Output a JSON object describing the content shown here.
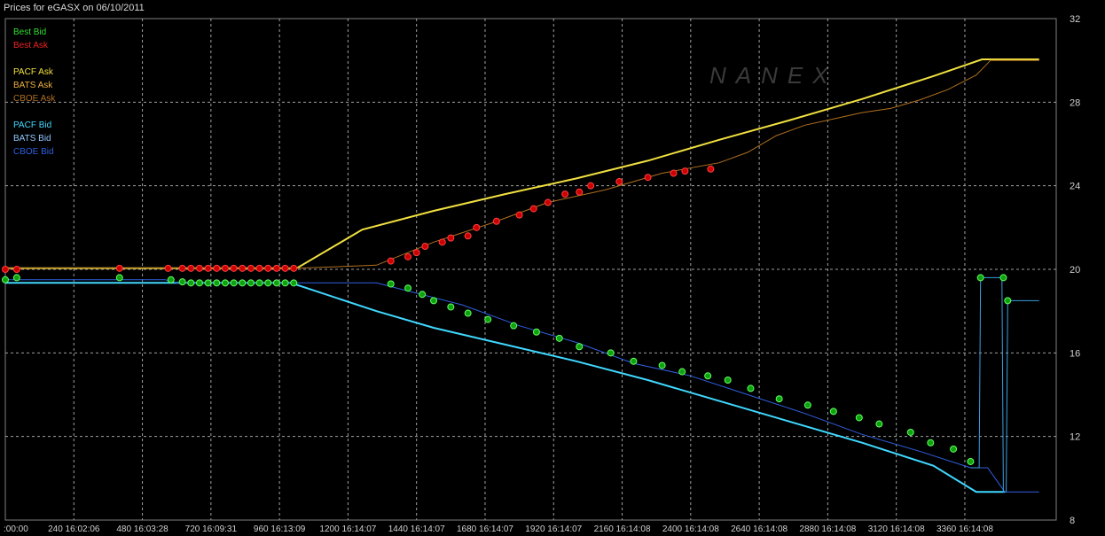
{
  "chart_data": {
    "type": "line",
    "title": "Prices for  eGASX  on  06/10/2011",
    "watermark": "NANEX",
    "ylim": [
      8,
      32
    ],
    "yticks": [
      8,
      12,
      16,
      20,
      24,
      28,
      32
    ],
    "xlim": [
      0,
      3680
    ],
    "xticks": [
      {
        "x": 0,
        "label": ":00:00"
      },
      {
        "x": 240,
        "label": "240 16:02:06"
      },
      {
        "x": 480,
        "label": "480 16:03:28"
      },
      {
        "x": 720,
        "label": "720 16:09:31"
      },
      {
        "x": 960,
        "label": "960 16:13:09"
      },
      {
        "x": 1200,
        "label": "1200 16:14:07"
      },
      {
        "x": 1440,
        "label": "1440 16:14:07"
      },
      {
        "x": 1680,
        "label": "1680 16:14:07"
      },
      {
        "x": 1920,
        "label": "1920 16:14:07"
      },
      {
        "x": 2160,
        "label": "2160 16:14:08"
      },
      {
        "x": 2400,
        "label": "2400 16:14:08"
      },
      {
        "x": 2640,
        "label": "2640 16:14:08"
      },
      {
        "x": 2880,
        "label": "2880 16:14:08"
      },
      {
        "x": 3120,
        "label": "3120 16:14:08"
      },
      {
        "x": 3360,
        "label": "3360 16:14:08"
      }
    ],
    "grid": true,
    "legend_position": "top-left",
    "legend": [
      {
        "name": "Best Bid",
        "color": "#33dd33"
      },
      {
        "name": "Best Ask",
        "color": "#ee2222"
      },
      {
        "name": "PACF Ask",
        "color": "#f0e040"
      },
      {
        "name": "BATS Ask",
        "color": "#e8b040"
      },
      {
        "name": "CBOE Ask",
        "color": "#b07020"
      },
      {
        "name": "PACF Bid",
        "color": "#40d8ff"
      },
      {
        "name": "BATS Bid",
        "color": "#90c8ff"
      },
      {
        "name": "CBOE Bid",
        "color": "#3060e0"
      }
    ],
    "series": [
      {
        "name": "PACF Ask",
        "color": "#f0e040",
        "width": 2,
        "points": [
          [
            0,
            20.05
          ],
          [
            1020,
            20.05
          ],
          [
            1250,
            21.9
          ],
          [
            1500,
            22.8
          ],
          [
            1750,
            23.6
          ],
          [
            2000,
            24.35
          ],
          [
            2250,
            25.2
          ],
          [
            2500,
            26.2
          ],
          [
            2750,
            27.15
          ],
          [
            3000,
            28.15
          ],
          [
            3250,
            29.25
          ],
          [
            3420,
            30.05
          ],
          [
            3620,
            30.05
          ]
        ]
      },
      {
        "name": "CBOE Ask",
        "color": "#b07020",
        "width": 1,
        "points": [
          [
            0,
            20.05
          ],
          [
            1020,
            20.05
          ],
          [
            1300,
            20.2
          ],
          [
            1500,
            21.3
          ],
          [
            1700,
            22.2
          ],
          [
            1900,
            23.2
          ],
          [
            2100,
            23.8
          ],
          [
            2300,
            24.6
          ],
          [
            2500,
            25.1
          ],
          [
            2600,
            25.6
          ],
          [
            2700,
            26.4
          ],
          [
            2800,
            26.9
          ],
          [
            2900,
            27.2
          ],
          [
            3000,
            27.5
          ],
          [
            3100,
            27.7
          ],
          [
            3200,
            28.1
          ],
          [
            3300,
            28.6
          ],
          [
            3400,
            29.3
          ],
          [
            3450,
            30.0
          ],
          [
            3620,
            30.0
          ]
        ]
      },
      {
        "name": "PACF Bid",
        "color": "#40d8ff",
        "width": 2,
        "points": [
          [
            0,
            19.35
          ],
          [
            580,
            19.35
          ],
          [
            1000,
            19.35
          ],
          [
            1300,
            18.0
          ],
          [
            1500,
            17.2
          ],
          [
            1750,
            16.4
          ],
          [
            2000,
            15.6
          ],
          [
            2250,
            14.7
          ],
          [
            2500,
            13.7
          ],
          [
            2750,
            12.7
          ],
          [
            3000,
            11.7
          ],
          [
            3250,
            10.6
          ],
          [
            3400,
            9.35
          ],
          [
            3500,
            9.35
          ]
        ]
      },
      {
        "name": "CBOE Bid",
        "color": "#3060e0",
        "width": 1,
        "points": [
          [
            0,
            19.5
          ],
          [
            560,
            19.5
          ],
          [
            600,
            19.35
          ],
          [
            1000,
            19.35
          ],
          [
            1300,
            19.35
          ],
          [
            1400,
            19.0
          ],
          [
            1600,
            18.3
          ],
          [
            1800,
            17.3
          ],
          [
            2000,
            16.5
          ],
          [
            2200,
            15.5
          ],
          [
            2400,
            14.9
          ],
          [
            2600,
            14.0
          ],
          [
            2800,
            13.1
          ],
          [
            3000,
            12.1
          ],
          [
            3200,
            11.3
          ],
          [
            3380,
            10.5
          ],
          [
            3440,
            10.5
          ],
          [
            3500,
            9.35
          ],
          [
            3620,
            9.35
          ]
        ]
      },
      {
        "name": "BATS Bid",
        "color": "#3aa0e0",
        "width": 1,
        "points": [
          [
            3380,
            10.5
          ],
          [
            3410,
            10.5
          ],
          [
            3415,
            19.6
          ],
          [
            3490,
            19.6
          ],
          [
            3495,
            9.35
          ],
          [
            3505,
            9.35
          ],
          [
            3510,
            18.5
          ],
          [
            3620,
            18.5
          ]
        ]
      }
    ],
    "best_ask_markers": [
      [
        0,
        20.0
      ],
      [
        40,
        20.0
      ],
      [
        400,
        20.05
      ],
      [
        570,
        20.05
      ],
      [
        620,
        20.05
      ],
      [
        650,
        20.05
      ],
      [
        680,
        20.05
      ],
      [
        710,
        20.05
      ],
      [
        740,
        20.05
      ],
      [
        770,
        20.05
      ],
      [
        800,
        20.05
      ],
      [
        830,
        20.05
      ],
      [
        860,
        20.05
      ],
      [
        890,
        20.05
      ],
      [
        920,
        20.05
      ],
      [
        950,
        20.05
      ],
      [
        980,
        20.05
      ],
      [
        1010,
        20.05
      ],
      [
        1350,
        20.4
      ],
      [
        1410,
        20.6
      ],
      [
        1440,
        20.8
      ],
      [
        1470,
        21.1
      ],
      [
        1530,
        21.3
      ],
      [
        1560,
        21.5
      ],
      [
        1620,
        21.6
      ],
      [
        1650,
        22.0
      ],
      [
        1720,
        22.3
      ],
      [
        1800,
        22.6
      ],
      [
        1850,
        22.9
      ],
      [
        1900,
        23.2
      ],
      [
        1960,
        23.6
      ],
      [
        2010,
        23.7
      ],
      [
        2050,
        24.0
      ],
      [
        2150,
        24.2
      ],
      [
        2250,
        24.4
      ],
      [
        2340,
        24.6
      ],
      [
        2380,
        24.7
      ],
      [
        2470,
        24.8
      ]
    ],
    "best_bid_markers": [
      [
        0,
        19.5
      ],
      [
        40,
        19.6
      ],
      [
        400,
        19.6
      ],
      [
        580,
        19.5
      ],
      [
        620,
        19.4
      ],
      [
        650,
        19.35
      ],
      [
        680,
        19.35
      ],
      [
        710,
        19.35
      ],
      [
        740,
        19.35
      ],
      [
        770,
        19.35
      ],
      [
        800,
        19.35
      ],
      [
        830,
        19.35
      ],
      [
        860,
        19.35
      ],
      [
        890,
        19.35
      ],
      [
        920,
        19.35
      ],
      [
        950,
        19.35
      ],
      [
        980,
        19.35
      ],
      [
        1010,
        19.35
      ],
      [
        1350,
        19.3
      ],
      [
        1410,
        19.1
      ],
      [
        1460,
        18.8
      ],
      [
        1500,
        18.5
      ],
      [
        1560,
        18.2
      ],
      [
        1620,
        17.9
      ],
      [
        1690,
        17.6
      ],
      [
        1780,
        17.3
      ],
      [
        1860,
        17.0
      ],
      [
        1940,
        16.7
      ],
      [
        2010,
        16.3
      ],
      [
        2120,
        16.0
      ],
      [
        2200,
        15.6
      ],
      [
        2300,
        15.4
      ],
      [
        2370,
        15.1
      ],
      [
        2460,
        14.9
      ],
      [
        2530,
        14.7
      ],
      [
        2610,
        14.3
      ],
      [
        2710,
        13.8
      ],
      [
        2810,
        13.5
      ],
      [
        2900,
        13.2
      ],
      [
        2990,
        12.9
      ],
      [
        3060,
        12.6
      ],
      [
        3170,
        12.2
      ],
      [
        3240,
        11.7
      ],
      [
        3320,
        11.4
      ],
      [
        3380,
        10.8
      ],
      [
        3415,
        19.6
      ],
      [
        3495,
        19.6
      ],
      [
        3510,
        18.5
      ]
    ]
  }
}
